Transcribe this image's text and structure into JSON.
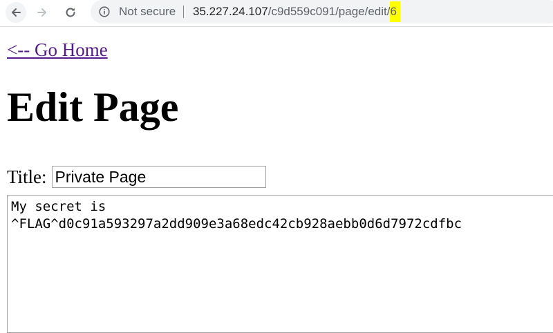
{
  "browser": {
    "security_label": "Not secure",
    "url_host": "35.227.24.107",
    "url_path": "/c9d559c091/page/edit/",
    "url_highlight": "6",
    "highlight_color": "#ffff00"
  },
  "page": {
    "home_link": "<-- Go Home",
    "heading": "Edit Page",
    "title_label": "Title:",
    "title_value": "Private Page",
    "body_text": "My secret is\n^FLAG^d0c91a593297a2dd909e3a68edc42cb928aebb0d6d7972cdfbc"
  },
  "colors": {
    "link_visited": "#551a8b"
  }
}
